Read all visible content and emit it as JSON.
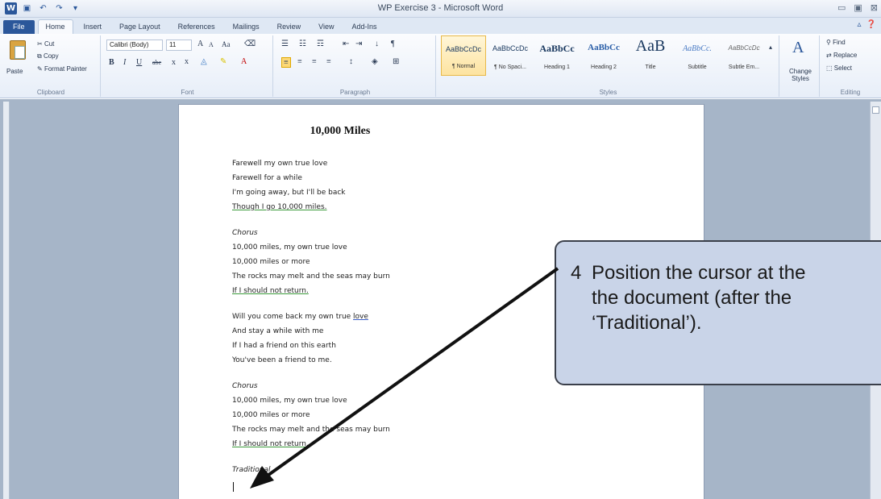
{
  "window": {
    "title": "WP Exercise 3 - Microsoft Word",
    "app_icon": "W",
    "quick_access": [
      "save-icon",
      "undo-icon",
      "redo-icon",
      "customize-icon"
    ],
    "controls": [
      "minimize-icon",
      "restore-icon",
      "close-icon"
    ],
    "control_glyphs": [
      "▭",
      "▣",
      "⊠"
    ]
  },
  "ribbon": {
    "tabs": [
      "File",
      "Home",
      "Insert",
      "Page Layout",
      "References",
      "Mailings",
      "Review",
      "View",
      "Add-Ins"
    ],
    "active_tab": "Home",
    "clipboard": {
      "label": "Clipboard",
      "paste": "Paste",
      "cut": "Cut",
      "copy": "Copy",
      "format_painter": "Format Painter"
    },
    "font": {
      "label": "Font",
      "name": "Calibri (Body)",
      "size": "11",
      "grow": "A",
      "shrink": "A",
      "case": "Aa",
      "bold": "B",
      "italic": "I",
      "underline": "U",
      "strikethrough": "abc",
      "subscript": "x",
      "superscript": "x"
    },
    "paragraph": {
      "label": "Paragraph",
      "show_marks": "¶",
      "sort": "↓"
    },
    "styles": {
      "label": "Styles",
      "items": [
        {
          "preview": "AaBbCcDc",
          "name": "¶ Normal"
        },
        {
          "preview": "AaBbCcDc",
          "name": "¶ No Spaci..."
        },
        {
          "preview": "AaBbCc",
          "name": "Heading 1"
        },
        {
          "preview": "AaBbCc",
          "name": "Heading 2"
        },
        {
          "preview": "AaB",
          "name": "Title"
        },
        {
          "preview": "AaBbCc.",
          "name": "Subtitle"
        },
        {
          "preview": "AaBbCcDc",
          "name": "Subtle Em..."
        }
      ],
      "change_styles": "Change Styles"
    },
    "editing": {
      "label": "Editing",
      "find": "Find",
      "replace": "Replace",
      "select": "Select"
    },
    "accent_color": "#2b579a"
  },
  "document": {
    "title": "10,000 Miles",
    "lines": [
      {
        "text": "Farewell my own true love",
        "style": "normal"
      },
      {
        "text": "Farewell for a while",
        "style": "normal"
      },
      {
        "text": "I'm going away, but I'll be back",
        "style": "normal"
      },
      {
        "text": "Though I go 10,000 miles.",
        "style": "underline"
      },
      {
        "text": "Chorus",
        "style": "italic"
      },
      {
        "text": "10,000 miles, my own true love",
        "style": "normal"
      },
      {
        "text": "10,000 miles or more",
        "style": "normal"
      },
      {
        "text": "The rocks may melt and the seas may burn",
        "style": "normal"
      },
      {
        "text": "If I should not return.",
        "style": "underline"
      },
      {
        "text_before": "Will you come back my own true ",
        "text_word": "love",
        "style": "partial"
      },
      {
        "text": "And stay a while with me",
        "style": "normal"
      },
      {
        "text": "If I had a friend on this earth",
        "style": "normal"
      },
      {
        "text": "You've been a friend to me.",
        "style": "normal"
      },
      {
        "text": "Chorus",
        "style": "italic"
      },
      {
        "text": "10,000 miles, my own true love",
        "style": "normal"
      },
      {
        "text": "10,000 miles or more",
        "style": "normal"
      },
      {
        "text": "The rocks may melt and the seas may burn",
        "style": "normal"
      },
      {
        "text": "If I should not return.",
        "style": "underline"
      },
      {
        "text": "Traditional",
        "style": "italic"
      }
    ]
  },
  "callout": {
    "number": "4",
    "line1": "Position the cursor at the",
    "line2": "the document (after the",
    "line3": "‘Traditional’).",
    "fill": "#c9d4e8"
  }
}
